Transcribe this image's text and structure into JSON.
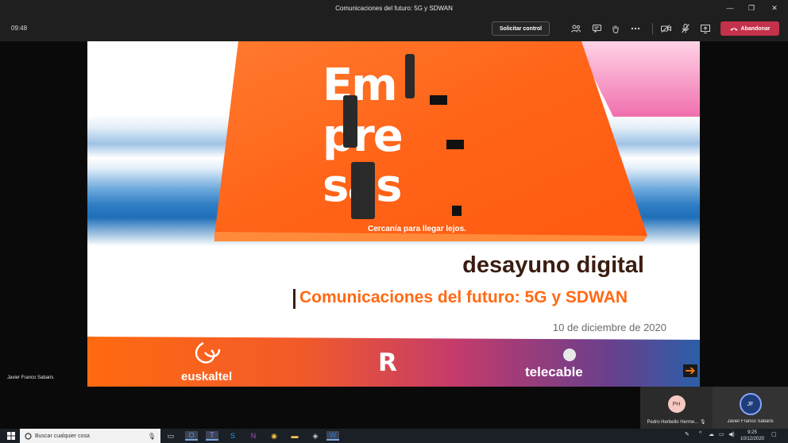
{
  "window": {
    "title": "Comunicaciones del futuro: 5G y SDWAN",
    "controls": [
      "—",
      "❐",
      "✕"
    ]
  },
  "toolbar": {
    "elapsed": "09:48",
    "request_control": "Solicitar control",
    "leave": "Abandonar",
    "leave_color": "#c4314b",
    "icons": [
      "participants-icon",
      "chat-icon",
      "raise-hand-icon",
      "more-options-icon",
      "camera-off-icon",
      "mic-off-icon",
      "share-screen-icon"
    ]
  },
  "slide": {
    "headline_lines": [
      "Em",
      "pre",
      "sas"
    ],
    "tagline": "Cercanía para llegar lejos.",
    "event": "desayuno digital",
    "subtitle": "Comunicaciones del futuro: 5G y SDWAN",
    "date": "10 de diciembre de 2020",
    "brands": {
      "left": "euskaltel",
      "center": "R",
      "right": "telecable"
    },
    "accent": "#ff6a14",
    "next_arrow": "➔"
  },
  "presenter_label": "Javier Franco Sabaris",
  "participants": [
    {
      "initials": "PH",
      "name": "Pedro Herbello Herme..."
    },
    {
      "initials": "JF",
      "name": "Javier Franco Sabaris"
    }
  ],
  "taskbar": {
    "search_placeholder": "Buscar cualquier cosa",
    "time": "9:25",
    "date": "10/12/2020"
  }
}
